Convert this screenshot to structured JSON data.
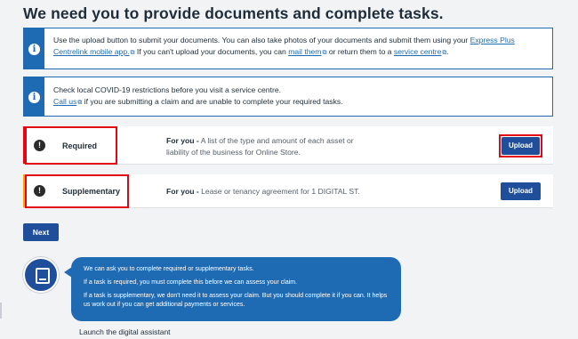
{
  "page": {
    "title": "We need you to provide documents and complete tasks."
  },
  "info1": {
    "text_a": "Use the upload button to submit your documents. You can also take photos of your documents and submit them using your",
    "link_app": "Express Plus Centrelink mobile app.",
    "text_b": "If you can't upload your documents, you can",
    "link_mail": "mail them",
    "text_c": "or return them to a",
    "link_centre": "service centre",
    "text_d": "."
  },
  "info2": {
    "line1": "Check local COVID-19 restrictions before you visit a service centre.",
    "link_call": "Call us",
    "line2": "if you are submitting a claim and are unable to complete your required tasks."
  },
  "tasks": [
    {
      "name": "Required",
      "for_label": "For you -",
      "desc": "A list of the type and amount of each asset or liability of the business for Online Store.",
      "button": "Upload",
      "accent": "#e30613"
    },
    {
      "name": "Supplementary",
      "for_label": "For you -",
      "desc": "Lease or tenancy agreement for 1 DIGITAL ST.",
      "button": "Upload",
      "accent": "#f2a900"
    }
  ],
  "next_label": "Next",
  "assistant": {
    "line1": "We can ask you to complete required or supplementary tasks.",
    "line2": "If a task is required, you must complete this before we can assess your claim.",
    "line3": "If a task is supplementary, we don't need it to assess your claim. But you should complete it if you can. It helps us work out if you can get additional payments or services.",
    "launch_label": "Launch the digital assistant"
  },
  "icons": {
    "info": "info-icon",
    "alert": "alert-icon",
    "external": "external-link-icon",
    "assistant": "digital-assistant-icon"
  },
  "colors": {
    "brand_blue": "#1f6bb3",
    "button_blue": "#1f4f9a",
    "highlight_red": "#e30613"
  }
}
